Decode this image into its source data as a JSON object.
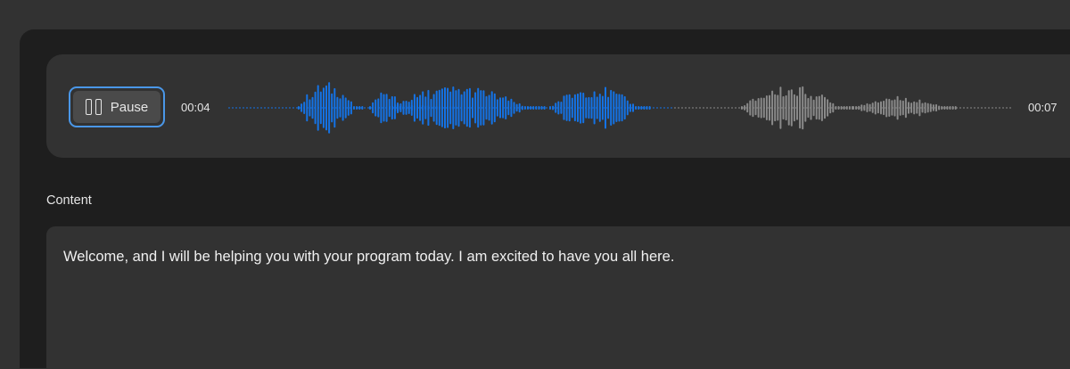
{
  "player": {
    "pause_label": "Pause",
    "current_time": "00:04",
    "total_time": "00:07",
    "played_color": "#1473e6",
    "unplayed_color": "#8a8a8a",
    "focus_color": "#4a97e8"
  },
  "content": {
    "label": "Content",
    "text": "Welcome, and I will be helping you with your program today. I am excited to have you all here."
  },
  "icons": {
    "pause": "pause-icon"
  }
}
